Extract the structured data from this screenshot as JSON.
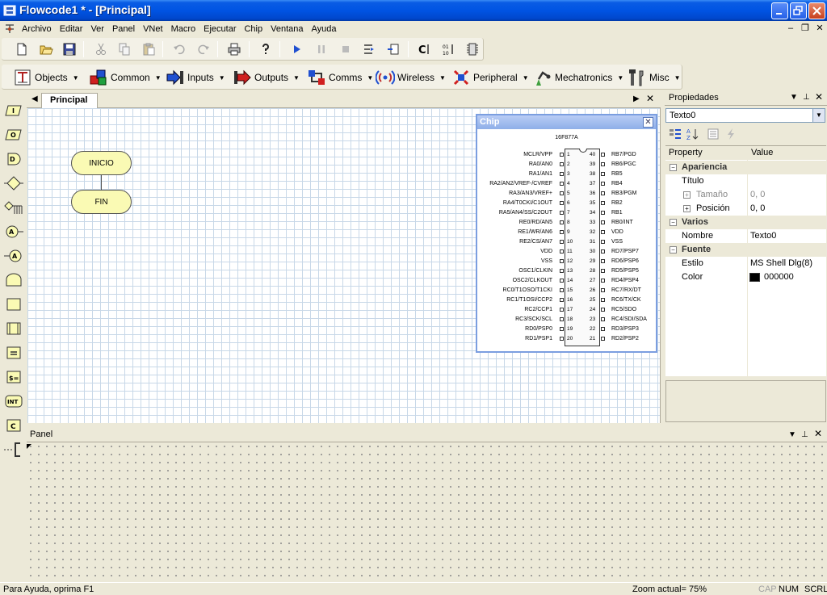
{
  "window": {
    "title": "Flowcode1 * - [Principal]"
  },
  "menu": {
    "items": [
      "Archivo",
      "Editar",
      "Ver",
      "Panel",
      "VNet",
      "Macro",
      "Ejecutar",
      "Chip",
      "Ventana",
      "Ayuda"
    ]
  },
  "components": {
    "items": [
      {
        "label": "Objects",
        "icon": "objects-icon"
      },
      {
        "label": "Common",
        "icon": "common-cubes-icon"
      },
      {
        "label": "Inputs",
        "icon": "inputs-icon"
      },
      {
        "label": "Outputs",
        "icon": "outputs-icon"
      },
      {
        "label": "Comms",
        "icon": "comms-icon"
      },
      {
        "label": "Wireless",
        "icon": "wireless-icon"
      },
      {
        "label": "Peripheral",
        "icon": "peripheral-icon"
      },
      {
        "label": "Mechatronics",
        "icon": "mechatronics-icon"
      },
      {
        "label": "Misc",
        "icon": "misc-tools-icon"
      }
    ]
  },
  "doc": {
    "tab": "Principal"
  },
  "flowchart": {
    "start": "INICIO",
    "end": "FIN"
  },
  "chip": {
    "title": "Chip",
    "name": "16F877A",
    "left_pins": [
      "MCLR/VPP",
      "RA0/AN0",
      "RA1/AN1",
      "RA2/AN2/VREF-/CVREF",
      "RA3/AN3/VREF+",
      "RA4/T0CKI/C1OUT",
      "RA5/AN4/SS/C2OUT",
      "RE0/RD/AN5",
      "RE1/WR/AN6",
      "RE2/CS/AN7",
      "VDD",
      "VSS",
      "OSC1/CLKIN",
      "OSC2/CLKOUT",
      "RC0/T1OSO/T1CKI",
      "RC1/T1OSI/CCP2",
      "RC2/CCP1",
      "RC3/SCK/SCL",
      "RD0/PSP0",
      "RD1/PSP1"
    ],
    "right_pins": [
      "RB7/PGD",
      "RB6/PGC",
      "RB5",
      "RB4",
      "RB3/PGM",
      "RB2",
      "RB1",
      "RB0/INT",
      "VDD",
      "VSS",
      "RD7/PSP7",
      "RD6/PSP6",
      "RD5/PSP5",
      "RD4/PSP4",
      "RC7/RX/DT",
      "RC6/TX/CK",
      "RC5/SDO",
      "RC4/SDI/SDA",
      "RD3/PSP3",
      "RD2/PSP2"
    ],
    "left_nums": [
      "1",
      "2",
      "3",
      "4",
      "5",
      "6",
      "7",
      "8",
      "9",
      "10",
      "11",
      "12",
      "13",
      "14",
      "15",
      "16",
      "17",
      "18",
      "19",
      "20"
    ],
    "right_nums": [
      "40",
      "39",
      "38",
      "37",
      "36",
      "35",
      "34",
      "33",
      "32",
      "31",
      "30",
      "29",
      "28",
      "27",
      "26",
      "25",
      "24",
      "23",
      "22",
      "21"
    ]
  },
  "props": {
    "title": "Propiedades",
    "selected": "Texto0",
    "col_property": "Property",
    "col_value": "Value",
    "rows": {
      "apariencia": "Apariencia",
      "titulo": "Título",
      "tamano": "Tamaño",
      "tamano_val": "0, 0",
      "posicion": "Posición",
      "posicion_val": "0, 0",
      "varios": "Varios",
      "nombre": "Nombre",
      "nombre_val": "Texto0",
      "fuente": "Fuente",
      "estilo": "Estilo",
      "estilo_val": "MS Shell Dlg(8)",
      "color": "Color",
      "color_val": "000000",
      "color_swatch": "#000000"
    }
  },
  "panel": {
    "title": "Panel"
  },
  "status": {
    "help": "Para Ayuda, oprima F1",
    "zoom": "Zoom actual= 75%",
    "cap": "CAP",
    "num": "NUM",
    "scrl": "SCRL"
  },
  "colors": {
    "titlebar": "#0054e3",
    "terminator_fill": "#fafab4",
    "chip_border": "#7b9ee0"
  }
}
